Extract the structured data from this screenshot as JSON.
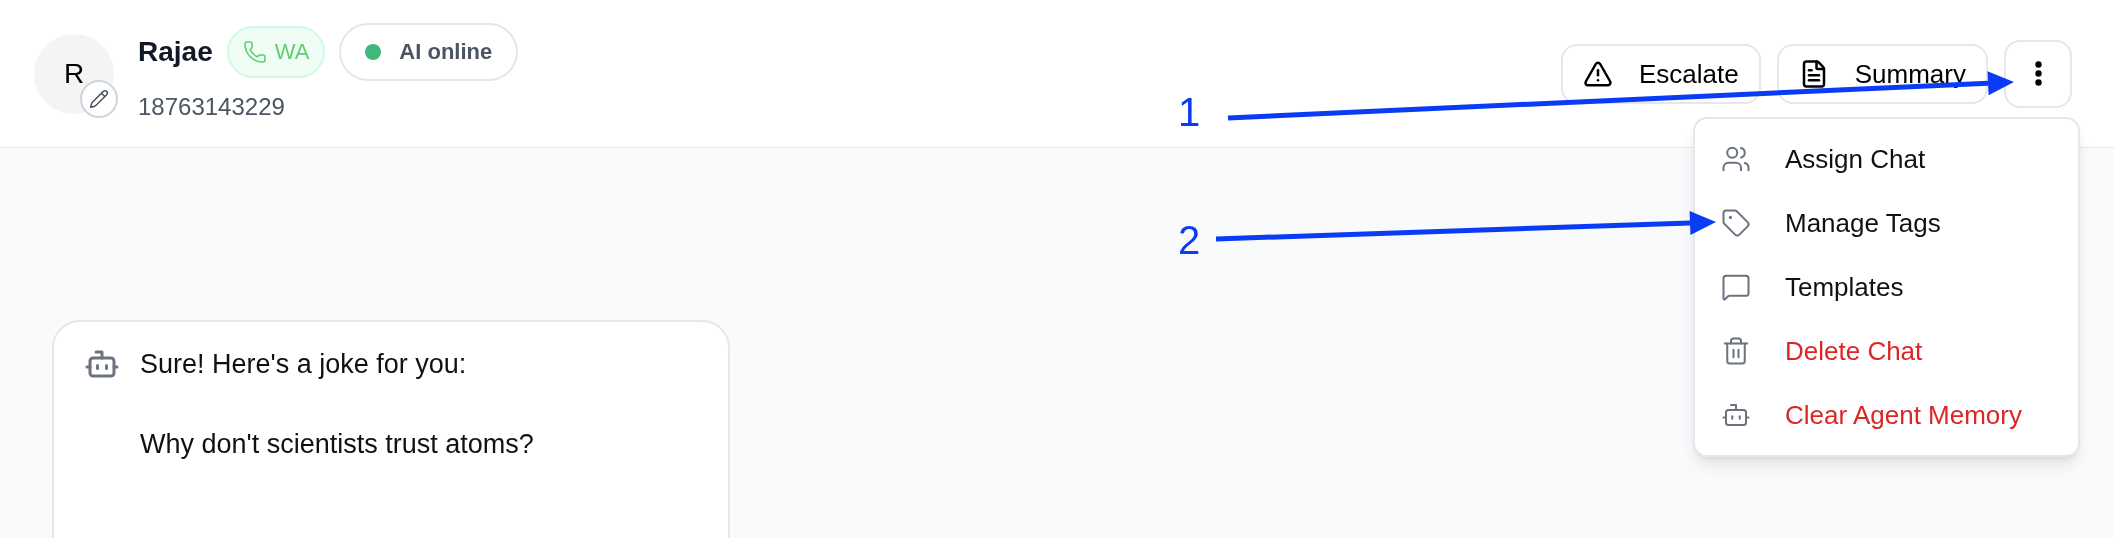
{
  "contact": {
    "initial": "R",
    "name": "Rajae",
    "channel_badge": "WA",
    "status": {
      "label": "AI online",
      "online": true
    },
    "phone": "18763143229"
  },
  "header_actions": [
    {
      "kind": "escalate",
      "label": "Escalate"
    },
    {
      "kind": "summary",
      "label": "Summary"
    },
    {
      "kind": "more"
    }
  ],
  "menu": {
    "items": [
      {
        "kind": "assign",
        "label": "Assign Chat",
        "danger": false
      },
      {
        "kind": "tags",
        "label": "Manage Tags",
        "danger": false
      },
      {
        "kind": "templates",
        "label": "Templates",
        "danger": false
      },
      {
        "kind": "delete",
        "label": "Delete Chat",
        "danger": true
      },
      {
        "kind": "memory",
        "label": "Clear Agent Memory",
        "danger": true
      }
    ]
  },
  "messages": [
    {
      "kind": "bot",
      "paragraphs": [
        "Sure! Here's a joke for you:",
        "Why don't scientists trust atoms?"
      ]
    }
  ],
  "annotations": [
    {
      "label": "1",
      "kind": "more"
    },
    {
      "label": "2",
      "kind": "tags"
    }
  ]
}
